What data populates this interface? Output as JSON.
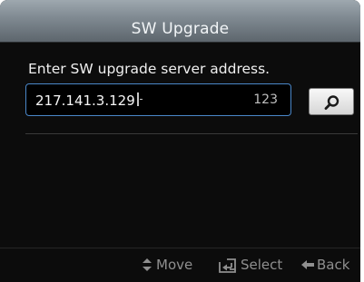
{
  "header": {
    "title": "SW Upgrade"
  },
  "form": {
    "prompt": "Enter SW upgrade server address.",
    "address_value": "217.141.3.129",
    "char_count": "123"
  },
  "footer": {
    "move_label": "Move",
    "select_label": "Select",
    "back_label": "Back",
    "move_icon": "up-down-arrows-icon",
    "select_icon": "enter-icon",
    "back_icon": "left-arrow-icon"
  },
  "colors": {
    "field_border": "#4a87c9",
    "background": "#0c0c0c",
    "footer_text": "#8f8f8f"
  }
}
